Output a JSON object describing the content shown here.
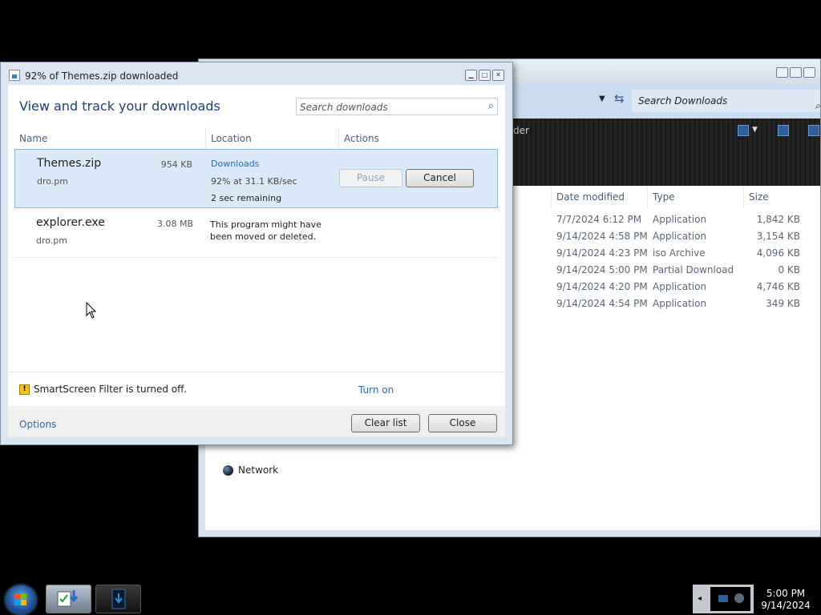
{
  "explorer": {
    "search_placeholder": "Search Downloads",
    "toolbar_text": "der",
    "columns": [
      "Date modified",
      "Type",
      "Size"
    ],
    "files": [
      {
        "date": "7/7/2024 6:12 PM",
        "type": "Application",
        "size": "1,842 KB"
      },
      {
        "date": "9/14/2024 4:58 PM",
        "type": "Application",
        "size": "3,154 KB"
      },
      {
        "date": "9/14/2024 4:23 PM",
        "type": "iso Archive",
        "size": "4,096 KB"
      },
      {
        "date": "9/14/2024 5:00 PM",
        "type": "Partial Download",
        "size": "0 KB"
      },
      {
        "date": "9/14/2024 4:20 PM",
        "type": "Application",
        "size": "4,746 KB"
      },
      {
        "date": "9/14/2024 4:54 PM",
        "type": "Application",
        "size": "349 KB"
      }
    ],
    "nav_network": "Network"
  },
  "dialog": {
    "title": "92% of Themes.zip downloaded",
    "heading": "View and track your downloads",
    "search_placeholder": "Search downloads",
    "columns": {
      "name": "Name",
      "location": "Location",
      "actions": "Actions"
    },
    "items": [
      {
        "name": "Themes.zip",
        "size": "954 KB",
        "source": "dro.pm",
        "location": "Downloads",
        "progress": "92% at 31.1 KB/sec",
        "remaining": "2 sec remaining",
        "pause_label": "Pause",
        "cancel_label": "Cancel"
      },
      {
        "name": "explorer.exe",
        "size": "3.08 MB",
        "source": "dro.pm",
        "message": "This program might have been moved or deleted."
      }
    ],
    "smartscreen_text": "SmartScreen Filter is turned off.",
    "turn_on_label": "Turn on",
    "options_label": "Options",
    "clear_list_label": "Clear list",
    "close_label": "Close"
  },
  "taskbar": {
    "time": "5:00 PM",
    "date": "9/14/2024"
  },
  "colors": {
    "link": "#2a6ab3",
    "heading": "#1e3c78",
    "selected_row": "#dbeaf8"
  }
}
